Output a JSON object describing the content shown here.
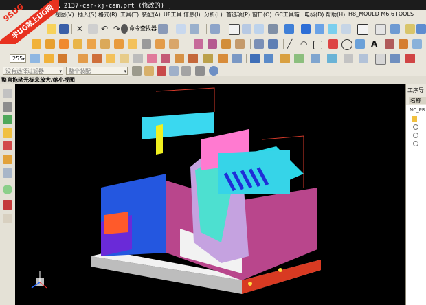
{
  "title_bar": {
    "text": "… 2137-car-xj-cam.prt (修改的) ]"
  },
  "watermark": {
    "brand": "9SUG",
    "slogan": "学UG就上UG网"
  },
  "menu": [
    "视图(V)",
    "插入(S)",
    "格式(R)",
    "工具(T)",
    "装配(A)",
    "UF工具",
    "信息(I)",
    "分析(L)",
    "首选项(P)",
    "窗口(O)",
    "GC工具箱",
    "电极(D)",
    "帮助(H)",
    "H8_MOULD M6.6",
    "TOOLS"
  ],
  "toolbar": {
    "command_finder": "命令查找器",
    "zoom_value": "255"
  },
  "selection_bar": {
    "filter_placeholder": "没有选择过滤器",
    "scope": "整个装配"
  },
  "view_hint": "整直拖动光标来放大/缩小视图",
  "navigator": {
    "title": "工序导",
    "column": "名称",
    "root": "NC_PR"
  },
  "colors": {
    "chrome": "#e9e6dc",
    "viewport": "#000000",
    "watermark": "#e8311f"
  }
}
